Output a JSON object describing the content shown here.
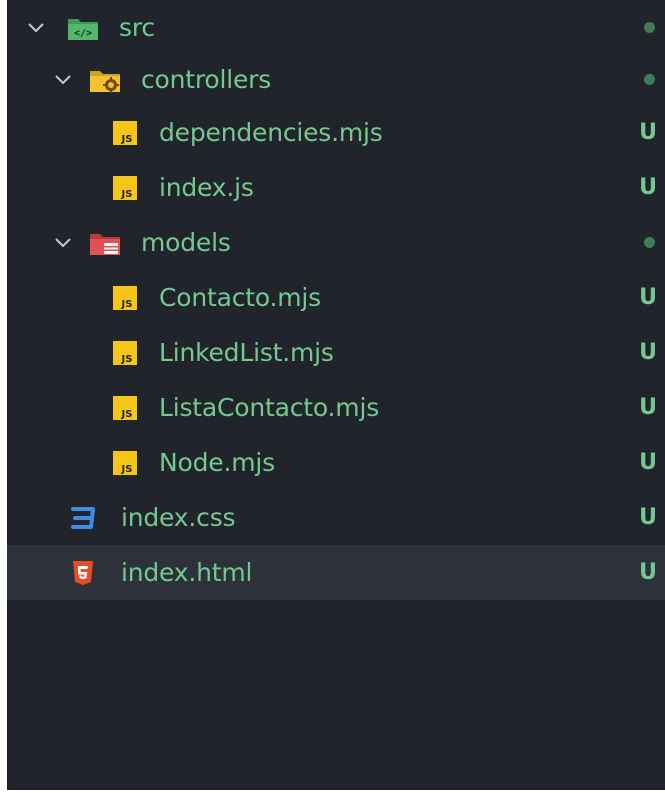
{
  "explorer": {
    "items": [
      {
        "label": "src",
        "type": "folder-src",
        "status": "dot"
      },
      {
        "label": "controllers",
        "type": "folder-controllers",
        "status": "dot"
      },
      {
        "label": "dependencies.mjs",
        "type": "js",
        "status": "U"
      },
      {
        "label": "index.js",
        "type": "js",
        "status": "U"
      },
      {
        "label": "models",
        "type": "folder-models",
        "status": "dot"
      },
      {
        "label": "Contacto.mjs",
        "type": "js",
        "status": "U"
      },
      {
        "label": "LinkedList.mjs",
        "type": "js",
        "status": "U"
      },
      {
        "label": "ListaContacto.mjs",
        "type": "js",
        "status": "U"
      },
      {
        "label": "Node.mjs",
        "type": "js",
        "status": "U"
      },
      {
        "label": "index.css",
        "type": "css",
        "status": "U"
      },
      {
        "label": "index.html",
        "type": "html",
        "status": "U",
        "selected": true
      }
    ]
  },
  "colors": {
    "background": "#21252b",
    "selected_row": "#2c313a",
    "untracked_text": "#73c991",
    "js_icon": "#f5c518",
    "css_icon": "#3a8ee6",
    "html_icon": "#e44d26"
  },
  "icons": {
    "chevron": "chevron-down-icon",
    "src": "folder-src-icon",
    "controllers": "folder-controllers-icon",
    "models": "folder-models-icon",
    "js": "js-file-icon",
    "css": "css-file-icon",
    "html": "html-file-icon"
  }
}
